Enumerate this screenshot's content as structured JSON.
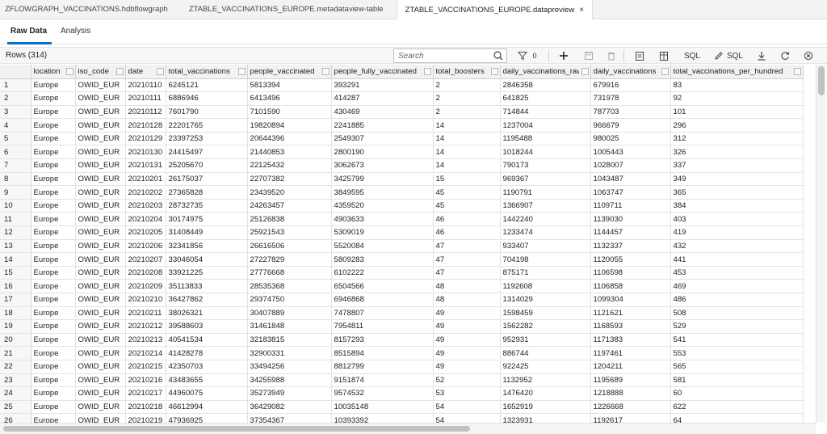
{
  "tabs": [
    {
      "label": "ZFLOWGRAPH_VACCINATIONS.hdbflowgraph"
    },
    {
      "label": "ZTABLE_VACCINATIONS_EUROPE.metadataview-table"
    },
    {
      "label": "ZTABLE_VACCINATIONS_EUROPE.datapreview"
    }
  ],
  "close_glyph": "×",
  "subtabs": {
    "raw": "Raw Data",
    "analysis": "Analysis"
  },
  "toolbar": {
    "rows_label": "Rows (314)",
    "search_placeholder": "Search",
    "filter_count": "0",
    "sql_label": "SQL",
    "edit_sql_label": "SQL"
  },
  "columns": [
    "location",
    "iso_code",
    "date",
    "total_vaccinations",
    "people_vaccinated",
    "people_fully_vaccinated",
    "total_boosters",
    "daily_vaccinations_raw",
    "daily_vaccinations",
    "total_vaccinations_per_hundred"
  ],
  "rows": [
    [
      "1",
      "Europe",
      "OWID_EUR",
      "20210110",
      "6245121",
      "5813394",
      "393291",
      "2",
      "2846358",
      "679916",
      "83"
    ],
    [
      "2",
      "Europe",
      "OWID_EUR",
      "20210111",
      "6886946",
      "6413496",
      "414287",
      "2",
      "641825",
      "731978",
      "92"
    ],
    [
      "3",
      "Europe",
      "OWID_EUR",
      "20210112",
      "7601790",
      "7101590",
      "430469",
      "2",
      "714844",
      "787703",
      "101"
    ],
    [
      "4",
      "Europe",
      "OWID_EUR",
      "20210128",
      "22201765",
      "19820894",
      "2241885",
      "14",
      "1237004",
      "966679",
      "296"
    ],
    [
      "5",
      "Europe",
      "OWID_EUR",
      "20210129",
      "23397253",
      "20644396",
      "2549307",
      "14",
      "1195488",
      "980025",
      "312"
    ],
    [
      "6",
      "Europe",
      "OWID_EUR",
      "20210130",
      "24415497",
      "21440853",
      "2800190",
      "14",
      "1018244",
      "1005443",
      "326"
    ],
    [
      "7",
      "Europe",
      "OWID_EUR",
      "20210131",
      "25205670",
      "22125432",
      "3062673",
      "14",
      "790173",
      "1028007",
      "337"
    ],
    [
      "8",
      "Europe",
      "OWID_EUR",
      "20210201",
      "26175037",
      "22707382",
      "3425799",
      "15",
      "969367",
      "1043487",
      "349"
    ],
    [
      "9",
      "Europe",
      "OWID_EUR",
      "20210202",
      "27365828",
      "23439520",
      "3849595",
      "45",
      "1190791",
      "1063747",
      "365"
    ],
    [
      "10",
      "Europe",
      "OWID_EUR",
      "20210203",
      "28732735",
      "24263457",
      "4359520",
      "45",
      "1366907",
      "1109711",
      "384"
    ],
    [
      "11",
      "Europe",
      "OWID_EUR",
      "20210204",
      "30174975",
      "25126838",
      "4903633",
      "46",
      "1442240",
      "1139030",
      "403"
    ],
    [
      "12",
      "Europe",
      "OWID_EUR",
      "20210205",
      "31408449",
      "25921543",
      "5309019",
      "46",
      "1233474",
      "1144457",
      "419"
    ],
    [
      "13",
      "Europe",
      "OWID_EUR",
      "20210206",
      "32341856",
      "26616506",
      "5520084",
      "47",
      "933407",
      "1132337",
      "432"
    ],
    [
      "14",
      "Europe",
      "OWID_EUR",
      "20210207",
      "33046054",
      "27227829",
      "5809283",
      "47",
      "704198",
      "1120055",
      "441"
    ],
    [
      "15",
      "Europe",
      "OWID_EUR",
      "20210208",
      "33921225",
      "27776668",
      "6102222",
      "47",
      "875171",
      "1106598",
      "453"
    ],
    [
      "16",
      "Europe",
      "OWID_EUR",
      "20210209",
      "35113833",
      "28535368",
      "6504566",
      "48",
      "1192608",
      "1106858",
      "469"
    ],
    [
      "17",
      "Europe",
      "OWID_EUR",
      "20210210",
      "36427862",
      "29374750",
      "6946868",
      "48",
      "1314029",
      "1099304",
      "486"
    ],
    [
      "18",
      "Europe",
      "OWID_EUR",
      "20210211",
      "38026321",
      "30407889",
      "7478807",
      "49",
      "1598459",
      "1121621",
      "508"
    ],
    [
      "19",
      "Europe",
      "OWID_EUR",
      "20210212",
      "39588603",
      "31461848",
      "7954811",
      "49",
      "1562282",
      "1168593",
      "529"
    ],
    [
      "20",
      "Europe",
      "OWID_EUR",
      "20210213",
      "40541534",
      "32183815",
      "8157293",
      "49",
      "952931",
      "1171383",
      "541"
    ],
    [
      "21",
      "Europe",
      "OWID_EUR",
      "20210214",
      "41428278",
      "32900331",
      "8515894",
      "49",
      "886744",
      "1197461",
      "553"
    ],
    [
      "22",
      "Europe",
      "OWID_EUR",
      "20210215",
      "42350703",
      "33494256",
      "8812799",
      "49",
      "922425",
      "1204211",
      "565"
    ],
    [
      "23",
      "Europe",
      "OWID_EUR",
      "20210216",
      "43483655",
      "34255988",
      "9151874",
      "52",
      "1132952",
      "1195689",
      "581"
    ],
    [
      "24",
      "Europe",
      "OWID_EUR",
      "20210217",
      "44960075",
      "35273949",
      "9574532",
      "53",
      "1476420",
      "1218888",
      "60"
    ],
    [
      "25",
      "Europe",
      "OWID_EUR",
      "20210218",
      "46612994",
      "36429082",
      "10035148",
      "54",
      "1652919",
      "1226668",
      "622"
    ],
    [
      "26",
      "Europe",
      "OWID_EUR",
      "20210219",
      "47936925",
      "37354367",
      "10393392",
      "54",
      "1323931",
      "1192617",
      "64"
    ]
  ]
}
